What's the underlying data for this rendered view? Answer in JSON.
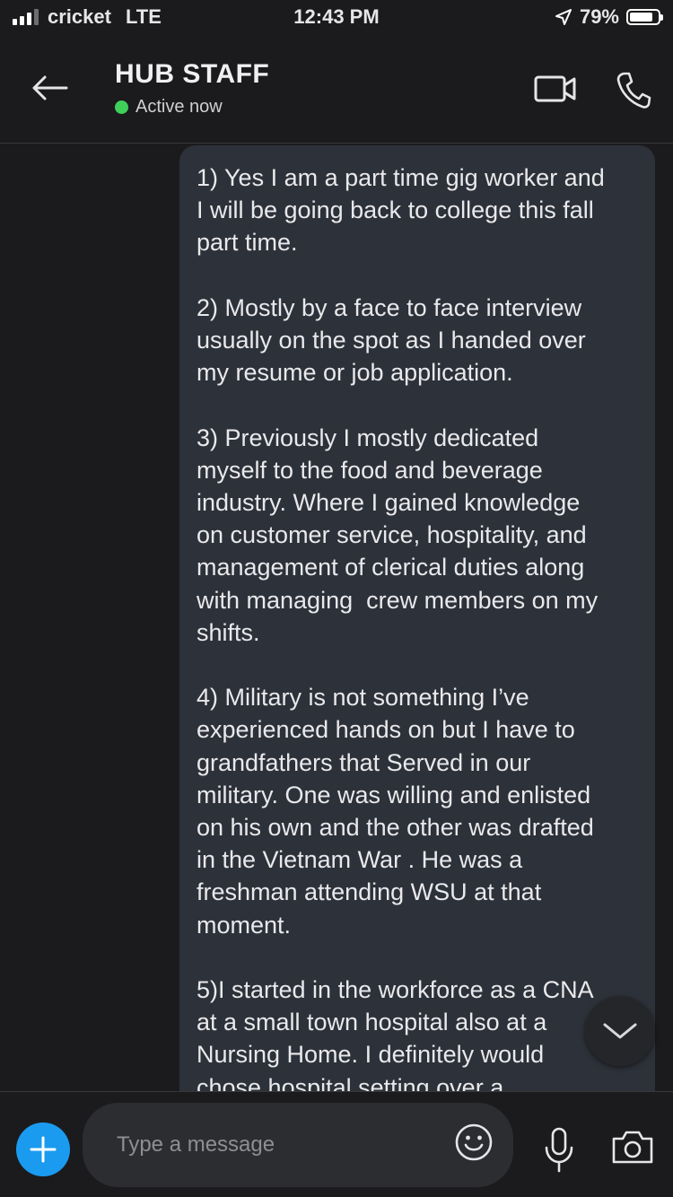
{
  "status_bar": {
    "carrier": "cricket",
    "network": "LTE",
    "time": "12:43 PM",
    "battery_percent": "79%",
    "battery_level": 0.79
  },
  "header": {
    "title": "HUB STAFF",
    "presence": "Active now",
    "presence_color": "#3fcf5b",
    "icons": [
      "back-arrow-icon",
      "video-call-icon",
      "phone-call-icon"
    ]
  },
  "message": {
    "bubble_color": "#2d3139",
    "paragraphs": [
      "1) Yes I am a part time gig worker and\nI will be going back to college this fall\npart time.",
      "2) Mostly by a face to face interview\nusually on the spot as I handed over\nmy resume or job application.",
      "3) Previously I mostly dedicated\nmyself to the food and beverage\nindustry. Where I gained knowledge\non customer service, hospitality, and\nmanagement of clerical duties along\nwith managing  crew members on my\nshifts.",
      "4) Military is not something I’ve\nexperienced hands on but I have to\ngrandfathers that Served in our\nmilitary. One was willing and enlisted\non his own and the other was drafted\nin the Vietnam War . He was a\nfreshman attending WSU at that\nmoment.",
      "5)I started in the workforce as a CNA\nat a small town hospital also at a\nNursing Home. I definitely would\nchose hospital setting over a"
    ]
  },
  "composer": {
    "placeholder": "Type a message",
    "accent": "#1a9bf0",
    "icons": [
      "plus-icon",
      "emoji-icon",
      "microphone-icon",
      "camera-icon"
    ]
  }
}
